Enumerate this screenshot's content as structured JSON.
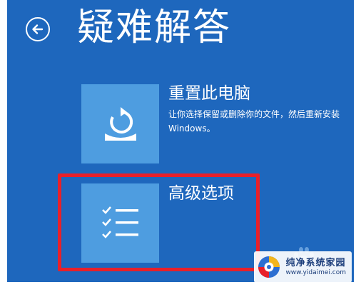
{
  "header": {
    "title": "疑难解答",
    "back_icon": "back-arrow-icon"
  },
  "options": [
    {
      "title": "重置此电脑",
      "description": "让你选择保留或删除你的文件，然后重新安装 Windows。",
      "icon": "reset-pc-icon"
    },
    {
      "title": "高级选项",
      "icon": "checklist-icon"
    }
  ],
  "watermark": {
    "name": "纯净系统家园",
    "url": "www.yidaimei.com"
  },
  "colors": {
    "background": "#1e67bd",
    "tile": "#4e9de0",
    "highlight": "#e8202a"
  }
}
